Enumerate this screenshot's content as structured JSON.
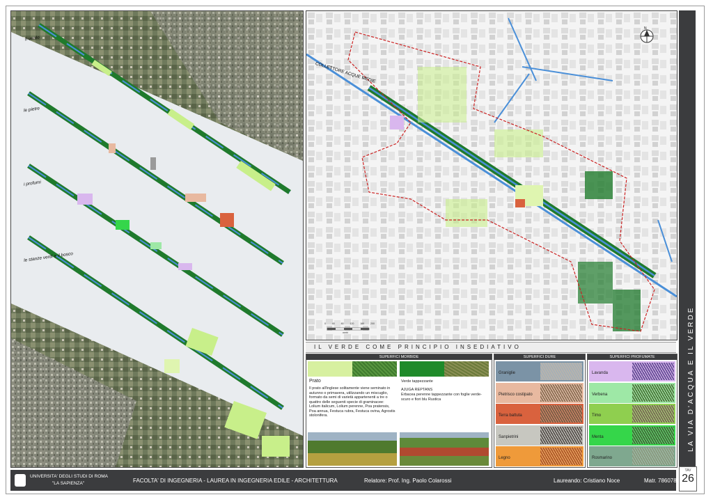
{
  "left_panel": {
    "labels": [
      "il verde",
      "le pietre",
      "i profumi",
      "le stanze verdi e il bosco"
    ]
  },
  "map": {
    "channel_label": "COLLETTORE ACQUE MEDIE",
    "compass_letter": "N",
    "scale_ticks": [
      "0",
      "40",
      "80",
      "120",
      "160",
      "200"
    ],
    "scale_unit": "metri"
  },
  "section_title": "IL VERDE COME PRINCIPIO INSEDIATIVO",
  "superfici_morbide": {
    "header": "SUPERFICI MORBIDE",
    "prato": {
      "title": "Prato",
      "text": "Il prato all'inglese solitamente viene seminato in autunno o primavera, utilizzando un miscuglio, formato da semi di varietà appartenenti a tre o quattro delle seguenti specie di graminacee: Lolium italicum, Lolium perenne, Poa pratensis, Poa annua, Festuca rubra, Festuca ovina, Agrostis stolonifera."
    },
    "verde_tappezzante": {
      "title": "Verde tappezzante",
      "subtitle": "AJUGA REPTANS",
      "text": "Erbacea perenne tappezzante con foglie verde-scuro e fiori blu Rustica"
    }
  },
  "superfici_dure": {
    "header": "SUPERFICI DURE",
    "items": [
      {
        "label": "Graniglie",
        "color": "#7b93a6",
        "texture": "#b7b3ac"
      },
      {
        "label": "Pietrisco costipato",
        "color": "#e8b9a0",
        "texture": "#8e7156"
      },
      {
        "label": "Terra battuta",
        "color": "#d9623e",
        "texture": "#7a6046"
      },
      {
        "label": "Sanpietrini",
        "color": "#c7c7c0",
        "texture": "#5a5550"
      },
      {
        "label": "Legno",
        "color": "#ef9a3a",
        "texture": "#b05a2a"
      }
    ]
  },
  "superfici_profumate": {
    "header": "SUPERFICI PROFUMATE",
    "items": [
      {
        "label": "Lavanda",
        "color": "#d9b7ee",
        "texture": "#6a4d9a"
      },
      {
        "label": "Verbena",
        "color": "#9ee8a6",
        "texture": "#4b7d3c"
      },
      {
        "label": "Timo",
        "color": "#8fcf4f",
        "texture": "#7a6a55"
      },
      {
        "label": "Menta",
        "color": "#35d64a",
        "texture": "#3f6e38"
      },
      {
        "label": "Rosmarino",
        "color": "#7fa88f",
        "texture": "#8a9a80"
      }
    ]
  },
  "footer": {
    "university_line1": "UNIVERSITA' DEGLI STUDI DI ROMA",
    "university_line2": "\"LA SAPIENZA\"",
    "faculty": "FACOLTA' DI INGEGNERIA  -  LAUREA IN INGEGNERIA EDILE - ARCHITETTURA",
    "relatore": "Relatore: Prof. Ing. Paolo Colarossi",
    "laureando": "Laureando: Cristiano Noce",
    "matricola": "Matr. 786078"
  },
  "vertical_title": "LA VIA D'ACQUA E IL VERDE",
  "tav_label": "TAV",
  "tav_number": "26",
  "colors": {
    "dark_green": "#1f7a2c",
    "light_green": "#c8ef8a",
    "water_blue": "#4a8fd8",
    "red_boundary": "#cc2222",
    "band_dark": "#3b3c3e"
  }
}
